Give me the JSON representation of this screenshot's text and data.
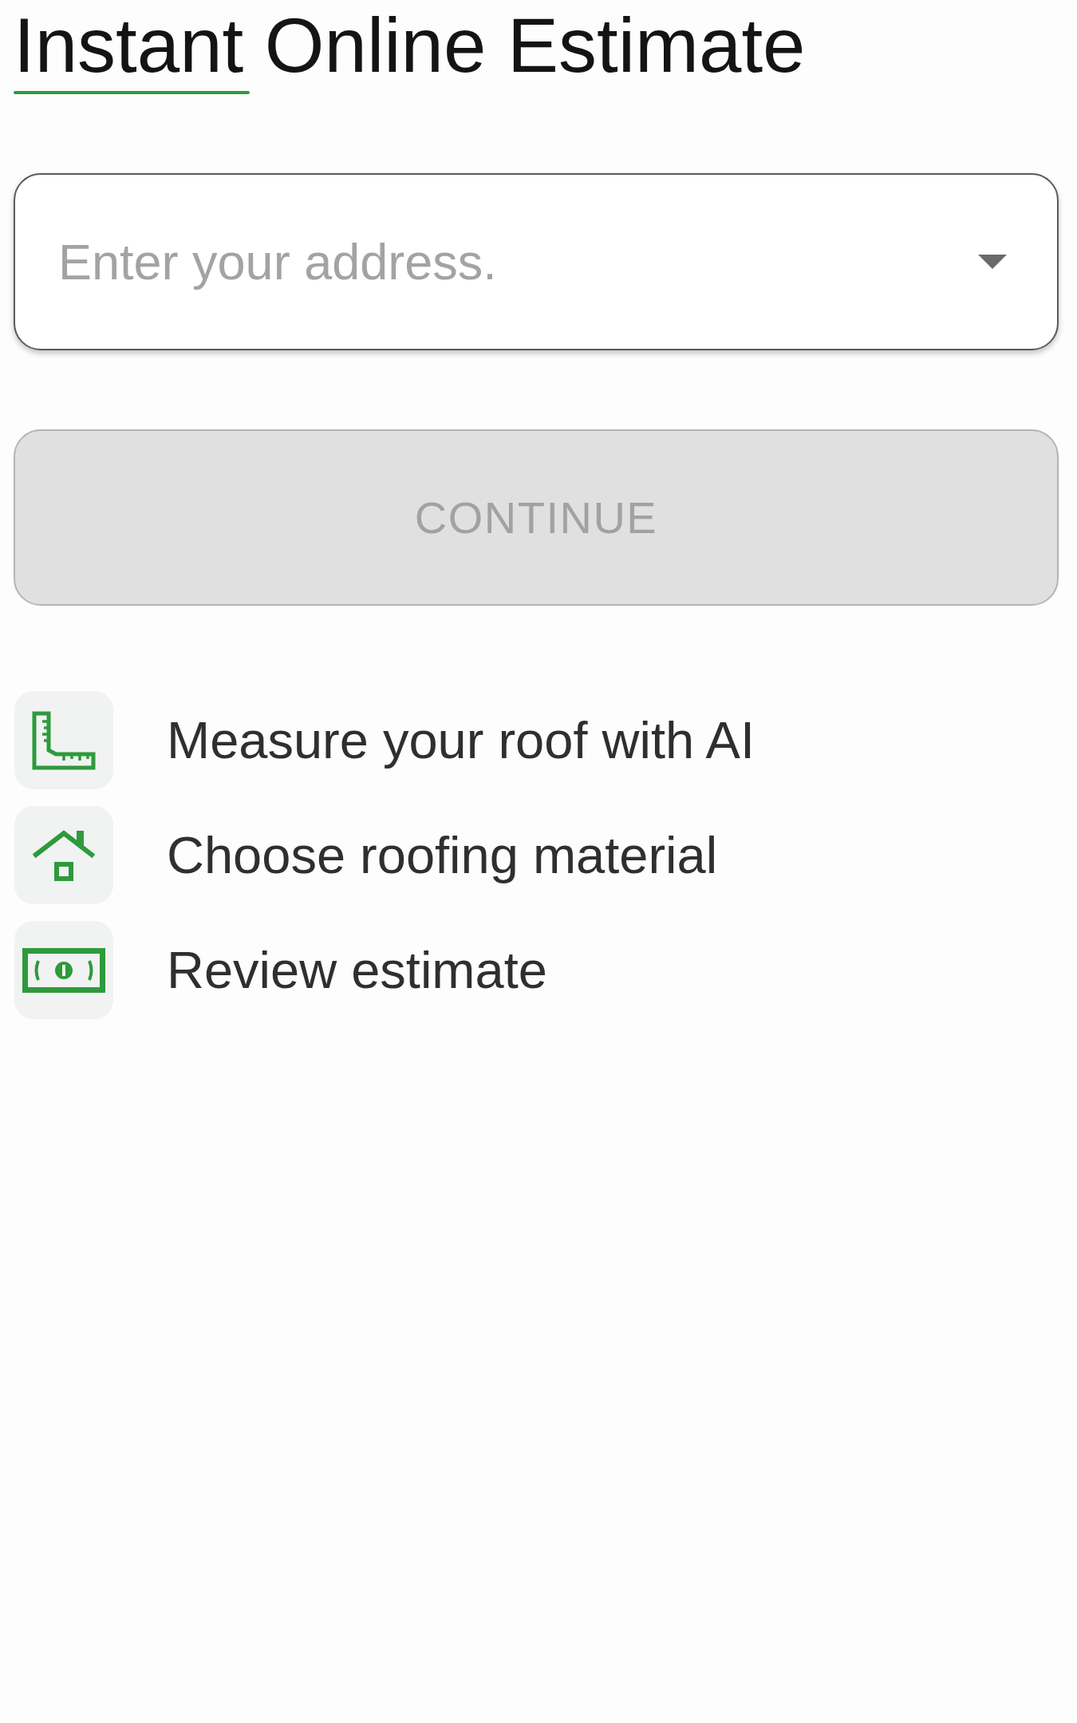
{
  "title": {
    "text": "Instant Online Estimate"
  },
  "address_field": {
    "placeholder": "Enter your address."
  },
  "continue_button": {
    "label": "CONTINUE",
    "disabled": true
  },
  "steps": [
    {
      "label": "Measure your roof with AI"
    },
    {
      "label": "Choose roofing material"
    },
    {
      "label": "Review estimate"
    }
  ]
}
